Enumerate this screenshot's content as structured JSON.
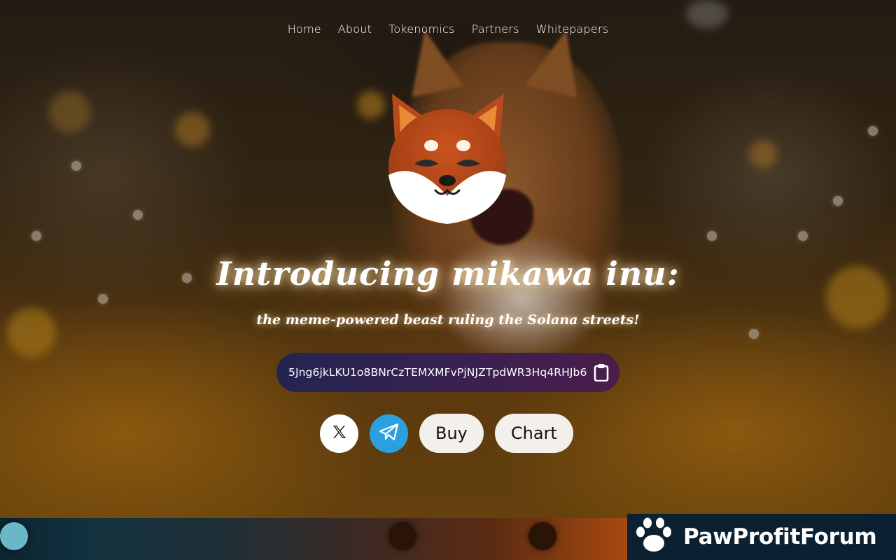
{
  "nav": {
    "items": [
      {
        "label": "Home"
      },
      {
        "label": "About"
      },
      {
        "label": "Tokenomics"
      },
      {
        "label": "Partners"
      },
      {
        "label": "Whitepapers"
      }
    ]
  },
  "hero": {
    "title": "Introducing mikawa inu:",
    "subtitle": "the meme-powered beast ruling the Solana streets!",
    "contract_address": "5Jng6jkLKU1o8BNrCzTEMXMFvPjNJZTpdWR3Hq4RHJb6",
    "copy_icon": "clipboard-icon",
    "logo_icon": "shiba-inu-face-logo"
  },
  "actions": {
    "x_icon": "x-logo-icon",
    "telegram_icon": "telegram-paper-plane-icon",
    "buy_label": "Buy",
    "chart_label": "Chart"
  },
  "watermark": {
    "text": "PawProfitForum",
    "icon": "paw-print-icon"
  },
  "colors": {
    "telegram_blue": "#2aa1de",
    "pill_bg": "#f3efea",
    "contract_gradient_start": "#232451",
    "contract_gradient_end": "#4a1d4a",
    "badge_bg": "#0b2030"
  }
}
